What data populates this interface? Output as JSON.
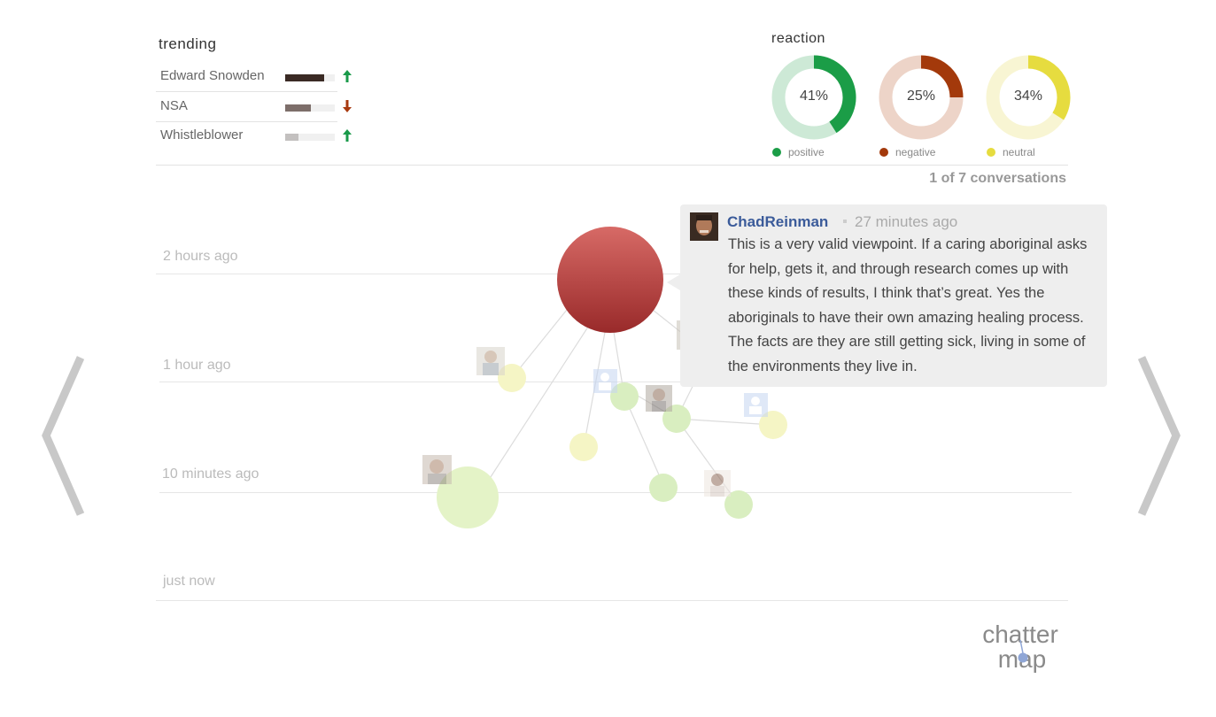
{
  "trending": {
    "title": "trending",
    "items": [
      {
        "label": "Edward Snowden",
        "level": 0.78,
        "color": "#3a2a24",
        "direction": "up",
        "arrow_icon": "arrow-up-icon"
      },
      {
        "label": "NSA",
        "level": 0.52,
        "color": "#7d6e6a",
        "direction": "down",
        "arrow_icon": "arrow-down-icon"
      },
      {
        "label": "Whistleblower",
        "level": 0.27,
        "color": "#c3c0bf",
        "direction": "up",
        "arrow_icon": "arrow-up-icon"
      }
    ],
    "colors": {
      "up": "#1a9a4a",
      "down": "#a83a10"
    }
  },
  "reaction": {
    "title": "reaction",
    "items": [
      {
        "label": "positive",
        "percent": 41,
        "percent_text": "41%",
        "color": "#1b9d47",
        "track": "#cde9d6"
      },
      {
        "label": "negative",
        "percent": 25,
        "percent_text": "25%",
        "color": "#a3390b",
        "track": "#edd4c8"
      },
      {
        "label": "neutral",
        "percent": 34,
        "percent_text": "34%",
        "color": "#e6dc3f",
        "track": "#f8f5d3"
      }
    ]
  },
  "conversation_count": "1 of 7 conversations",
  "timeline": {
    "labels": [
      "2 hours ago",
      "1 hour ago",
      "10 minutes ago",
      "just now"
    ]
  },
  "tooltip": {
    "user": "ChadReinman",
    "time": "27 minutes ago",
    "text": "This is a very valid viewpoint. If a caring aboriginal asks for help, gets it, and through research comes up with these kinds of results, I think that’s great. Yes the aboriginals to have their own amazing healing process. The facts are they are still getting sick, living in some of the environments they live in.",
    "avatar_icon": "user-avatar-icon"
  },
  "navigation": {
    "prev_icon": "chevron-left-icon",
    "next_icon": "chevron-right-icon"
  },
  "logo": {
    "line1": "chatter",
    "line2": "map"
  }
}
